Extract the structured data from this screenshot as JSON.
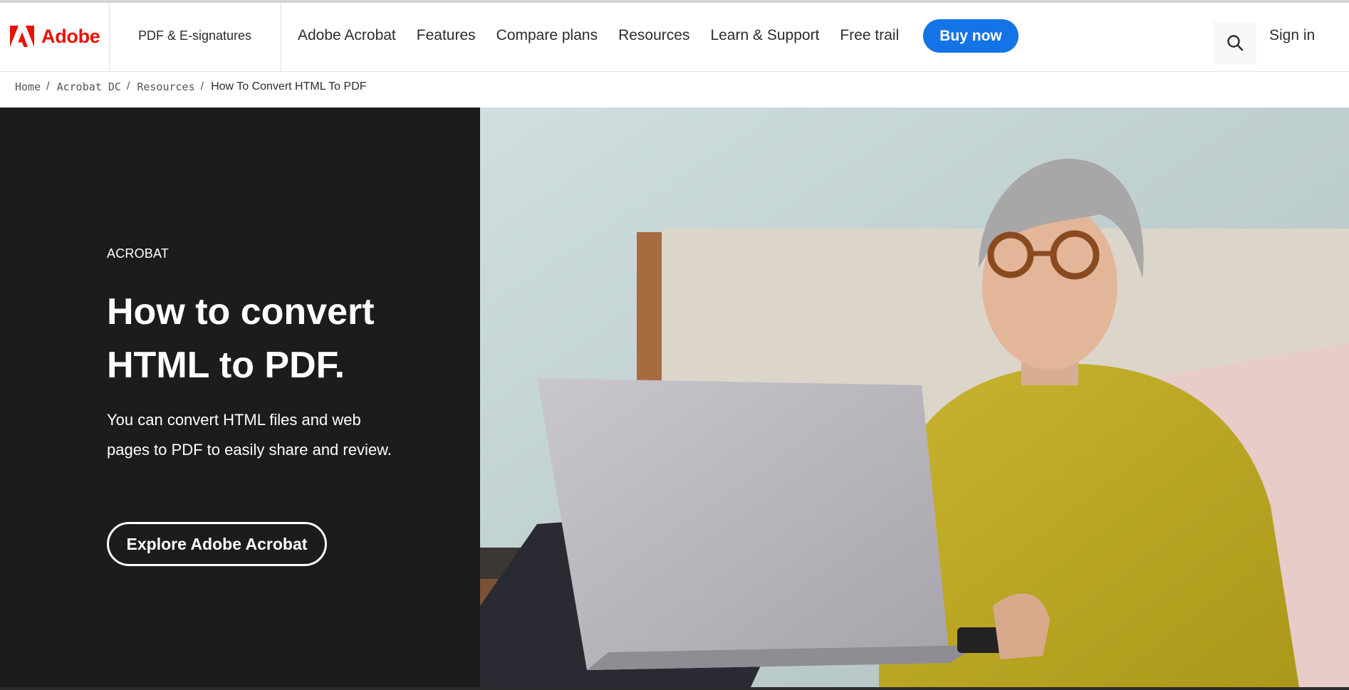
{
  "brand": {
    "name": "Adobe",
    "color": "#eb1000",
    "icon": "adobe-logo-icon"
  },
  "nav": {
    "product": "PDF & E-signatures",
    "items": [
      "Adobe Acrobat",
      "Features",
      "Compare plans",
      "Resources",
      "Learn & Support",
      "Free trail"
    ],
    "buy_label": "Buy now",
    "buy_color": "#1473e6",
    "search_icon": "search-icon",
    "signin_label": "Sign in"
  },
  "breadcrumb": {
    "links": [
      "Home",
      "Acrobat DC",
      "Resources"
    ],
    "separator": "/",
    "current": "How To Convert HTML To PDF"
  },
  "hero": {
    "eyebrow": "ACROBAT",
    "title_line1": "How to convert",
    "title_line2": "HTML to PDF.",
    "description": "You can convert HTML files and web pages to PDF to easily share and review.",
    "cta_label": "Explore Adobe Acrobat",
    "panel_color": "#1c1c1c"
  }
}
